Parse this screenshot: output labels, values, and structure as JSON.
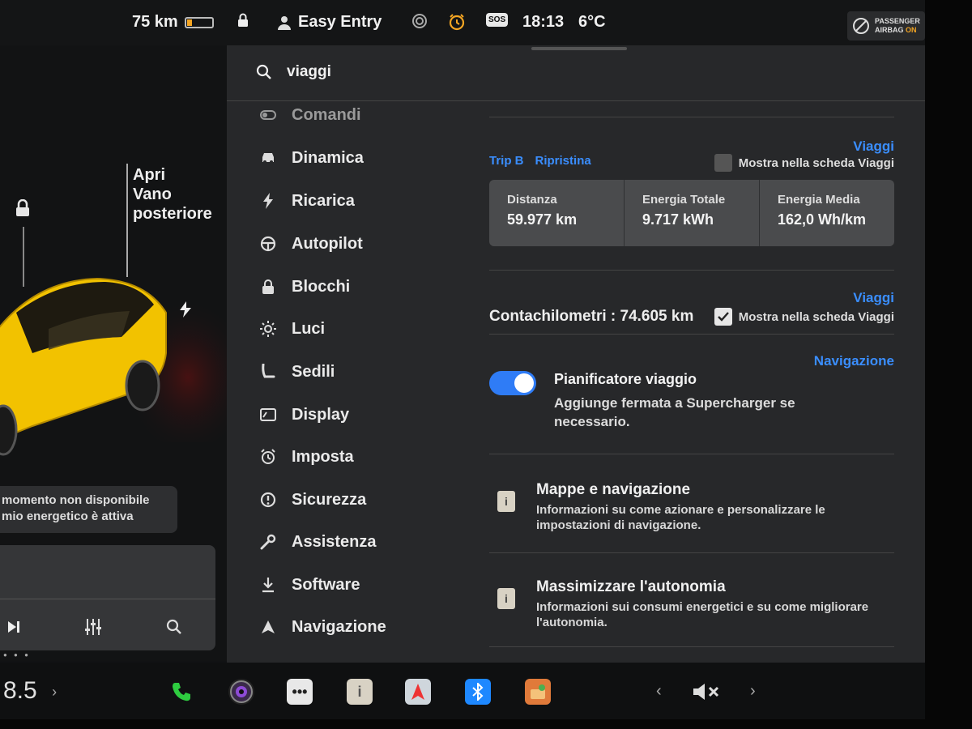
{
  "status": {
    "range": "75 km",
    "profile": "Easy Entry",
    "sos": "SOS",
    "time": "18:13",
    "temperature": "6°C",
    "airbag_line1": "PASSENGER",
    "airbag_line2": "AIRBAG",
    "airbag_state": "ON"
  },
  "car": {
    "trunk_label_1": "Apri",
    "trunk_label_2": "Vano",
    "trunk_label_3": "posteriore",
    "notice_line1": "momento non disponibile",
    "notice_line2": "mio energetico è attiva",
    "body_color": "#f2c200"
  },
  "search": {
    "value": "viaggi"
  },
  "menu": [
    {
      "label": "Comandi",
      "icon": "toggle-icon"
    },
    {
      "label": "Dinamica",
      "icon": "car-icon"
    },
    {
      "label": "Ricarica",
      "icon": "bolt-icon"
    },
    {
      "label": "Autopilot",
      "icon": "steering-wheel-icon"
    },
    {
      "label": "Blocchi",
      "icon": "lock-icon"
    },
    {
      "label": "Luci",
      "icon": "sun-icon"
    },
    {
      "label": "Sedili",
      "icon": "seat-icon"
    },
    {
      "label": "Display",
      "icon": "display-icon"
    },
    {
      "label": "Imposta",
      "icon": "alarm-clock-icon"
    },
    {
      "label": "Sicurezza",
      "icon": "alert-circle-icon"
    },
    {
      "label": "Assistenza",
      "icon": "wrench-icon"
    },
    {
      "label": "Software",
      "icon": "download-icon"
    },
    {
      "label": "Navigazione",
      "icon": "navigation-arrow-icon"
    }
  ],
  "trips": {
    "section_link": "Viaggi",
    "trip_name": "Trip B",
    "reset_label": "Ripristina",
    "show_in_tab_label": "Mostra nella scheda Viaggi",
    "distance_label": "Distanza",
    "distance_value": "59.977 km",
    "energy_total_label": "Energia Totale",
    "energy_total_value": "9.717 kWh",
    "energy_avg_label": "Energia Media",
    "energy_avg_value": "162,0 Wh/km"
  },
  "odometer": {
    "section_link": "Viaggi",
    "text": "Contachilometri : 74.605 km",
    "show_in_tab_label": "Mostra nella scheda Viaggi"
  },
  "planner": {
    "section_link": "Navigazione",
    "title": "Pianificatore viaggio",
    "description": "Aggiunge fermata a Supercharger se necessario."
  },
  "info_items": [
    {
      "title": "Mappe e navigazione",
      "description": "Informazioni su come azionare e personalizzare le impostazioni di navigazione."
    },
    {
      "title": "Massimizzare l'autonomia",
      "description": "Informazioni sui consumi energetici e su come migliorare l'autonomia."
    }
  ],
  "taskbar": {
    "speed": "8.5",
    "accent_phone": "#2ecc40",
    "accent_bluetooth": "#1e88ff"
  }
}
